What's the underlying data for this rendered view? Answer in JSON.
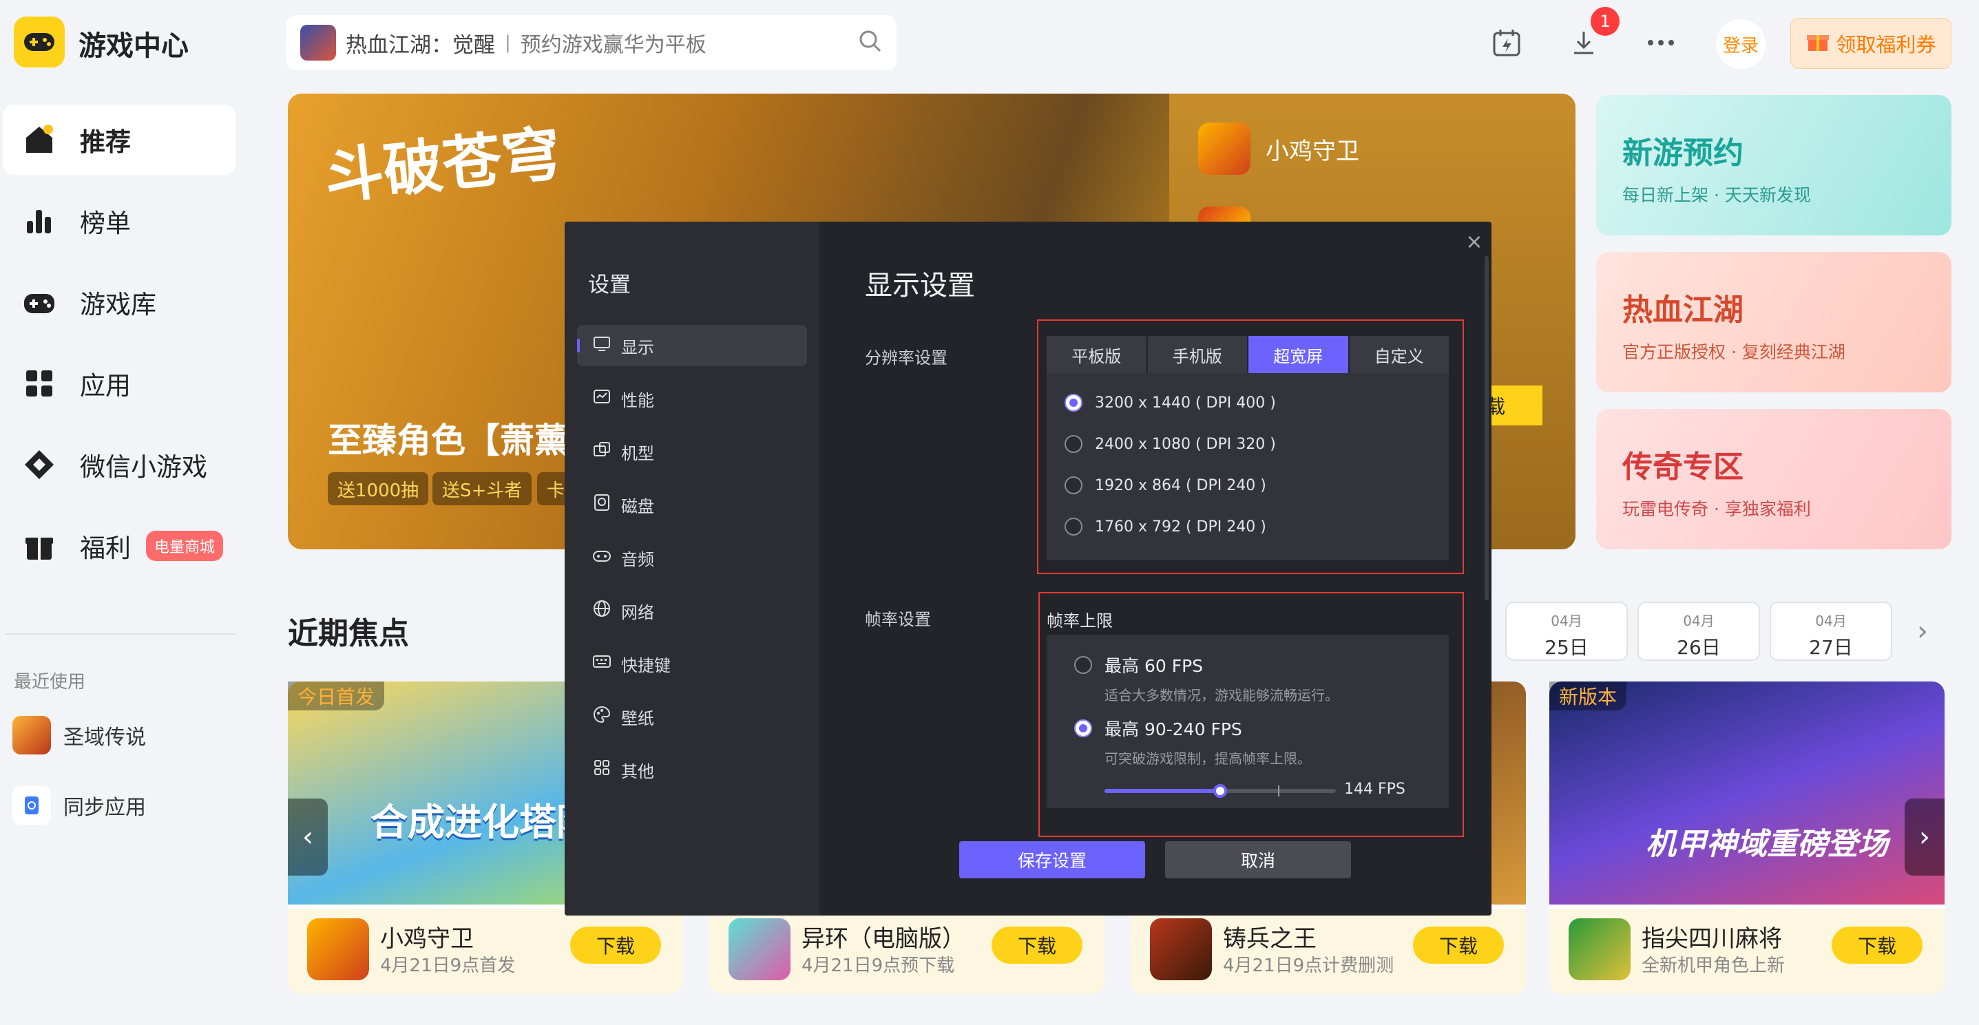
{
  "header": {
    "app_title": "游戏中心",
    "search": {
      "game": "热血江湖：觉醒",
      "separator": "|",
      "placeholder": "预约游戏赢华为平板"
    },
    "download_badge": "1",
    "login_label": "登录",
    "coupon_label": "领取福利券"
  },
  "sidebar": {
    "items": [
      {
        "label": "推荐",
        "icon": "home-icon",
        "active": true
      },
      {
        "label": "榜单",
        "icon": "chart-icon"
      },
      {
        "label": "游戏库",
        "icon": "gamepad-icon"
      },
      {
        "label": "应用",
        "icon": "apps-icon"
      },
      {
        "label": "微信小游戏",
        "icon": "diamond-icon"
      },
      {
        "label": "福利",
        "icon": "gift-icon",
        "tag": "电量商城"
      }
    ],
    "recent_label": "最近使用",
    "recent": [
      {
        "label": "圣域传说"
      },
      {
        "label": "同步应用"
      }
    ]
  },
  "banner": {
    "logo_text": "斗破苍穹",
    "title": "至臻角色【萧薰",
    "chips": [
      "送1000抽",
      "送S+斗者",
      "卡"
    ],
    "side_game": "小鸡守卫",
    "download_fragment": "载"
  },
  "promos": [
    {
      "title": "新游预约",
      "subtitle": "每日新上架 · 天天新发现"
    },
    {
      "title": "热血江湖",
      "subtitle": "官方正版授权 · 复刻经典江湖"
    },
    {
      "title": "传奇专区",
      "subtitle": "玩雷电传奇 · 享独家福利"
    }
  ],
  "focus": {
    "title": "近期焦点",
    "dates": [
      {
        "month": "04月",
        "day": "25日"
      },
      {
        "month": "04月",
        "day": "26日"
      },
      {
        "month": "04月",
        "day": "27日"
      }
    ],
    "cards": [
      {
        "tag": "今日首发",
        "name": "小鸡守卫",
        "sub": "4月21日9点首发",
        "btn": "下载",
        "art": "合成进化塔防"
      },
      {
        "name": "异环（电脑版）",
        "sub": "4月21日9点预下载",
        "btn": "下载"
      },
      {
        "name": "铸兵之王",
        "sub": "4月21日9点计费删测",
        "btn": "下载"
      },
      {
        "tag": "新版本",
        "name": "指尖四川麻将",
        "sub": "全新机甲角色上新",
        "btn": "下载",
        "art": "机甲神域重磅登场"
      }
    ]
  },
  "settings": {
    "title": "设置",
    "nav": [
      {
        "label": "显示",
        "icon": "monitor-icon",
        "active": true
      },
      {
        "label": "性能",
        "icon": "performance-icon"
      },
      {
        "label": "机型",
        "icon": "device-icon"
      },
      {
        "label": "磁盘",
        "icon": "disk-icon"
      },
      {
        "label": "音频",
        "icon": "audio-icon"
      },
      {
        "label": "网络",
        "icon": "globe-icon"
      },
      {
        "label": "快捷键",
        "icon": "keyboard-icon"
      },
      {
        "label": "壁纸",
        "icon": "palette-icon"
      },
      {
        "label": "其他",
        "icon": "grid-icon"
      }
    ],
    "page_title": "显示设置",
    "resolution_label": "分辨率设置",
    "tabs": [
      "平板版",
      "手机版",
      "超宽屏",
      "自定义"
    ],
    "active_tab": "超宽屏",
    "resolutions": [
      {
        "label": "3200 x 1440 ( DPI 400 )",
        "selected": true
      },
      {
        "label": "2400 x 1080 ( DPI 320 )"
      },
      {
        "label": "1920 x 864 ( DPI 240 )"
      },
      {
        "label": "1760 x 792 ( DPI 240 )"
      }
    ],
    "fps_label": "帧率设置",
    "fps_heading": "帧率上限",
    "fps_options": [
      {
        "label": "最高 60 FPS",
        "desc": "适合大多数情况，游戏能够流畅运行。"
      },
      {
        "label": "最高 90-240 FPS",
        "desc": "可突破游戏限制，提高帧率上限。",
        "selected": true
      }
    ],
    "fps_value": "144 FPS",
    "fps_slider_fraction": 0.5,
    "save_label": "保存设置",
    "cancel_label": "取消"
  },
  "colors": {
    "accent": "#6c63ff",
    "brand_yellow": "#ffd21a",
    "highlight_red": "#e53935"
  }
}
